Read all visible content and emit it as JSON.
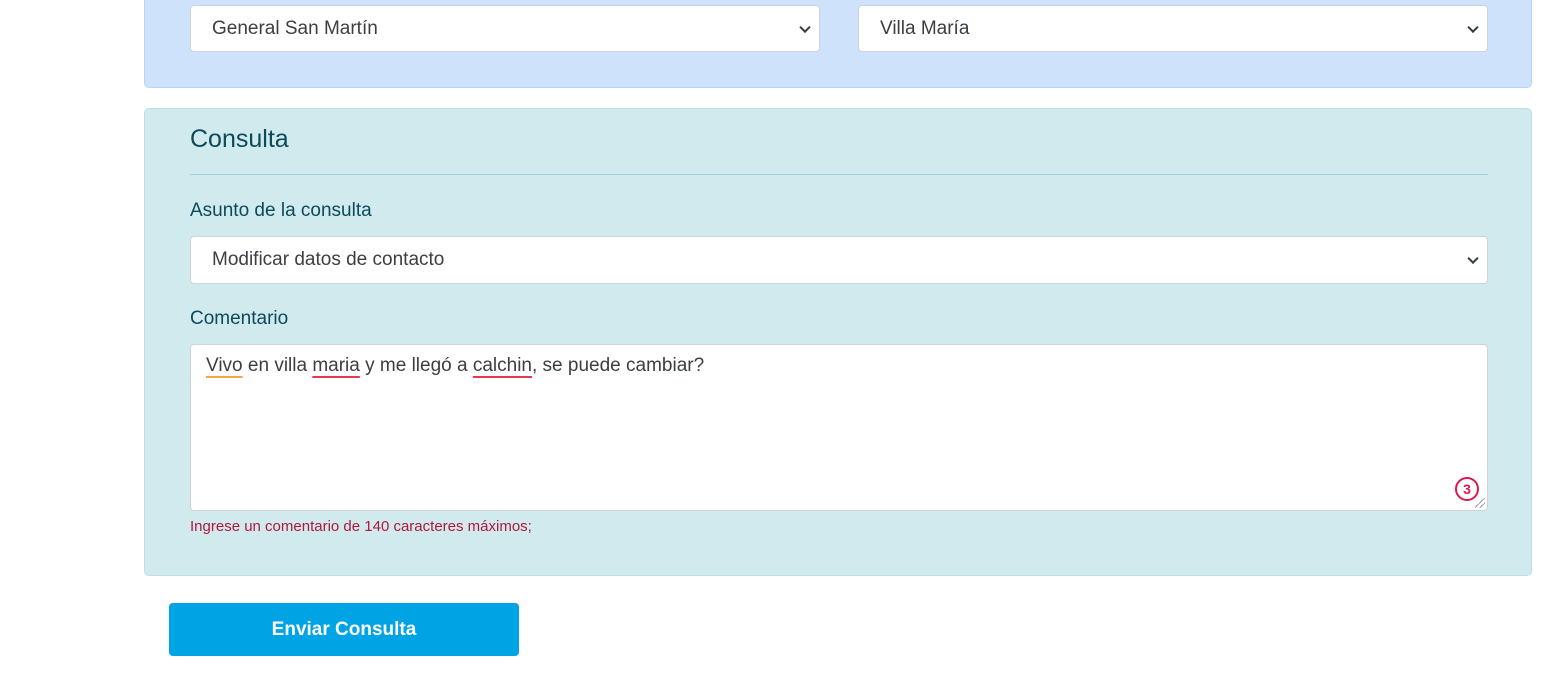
{
  "location": {
    "province_value": "General San Martín",
    "city_value": "Villa María"
  },
  "consulta": {
    "title": "Consulta",
    "subject_label": "Asunto de la consulta",
    "subject_value": "Modificar datos de contacto",
    "comment_label": "Comentario",
    "comment_segments": [
      "Vivo",
      " en villa ",
      "maria",
      " y me llegó a ",
      "calchin",
      ", se puede cambiar?"
    ],
    "grammar_count": "3",
    "hint": "Ingrese un comentario de 140 caracteres máximos;"
  },
  "actions": {
    "submit_label": "Enviar Consulta"
  },
  "colors": {
    "location_panel_bg": "#cfe2fb",
    "consulta_panel_bg": "#d1eaee",
    "submit_bg": "#00a4e4",
    "hint_color": "#b0173b"
  },
  "icons": {
    "dropdown": "chevron-down-icon",
    "grammar": "grammar-check-icon",
    "resize": "resize-handle-icon"
  }
}
